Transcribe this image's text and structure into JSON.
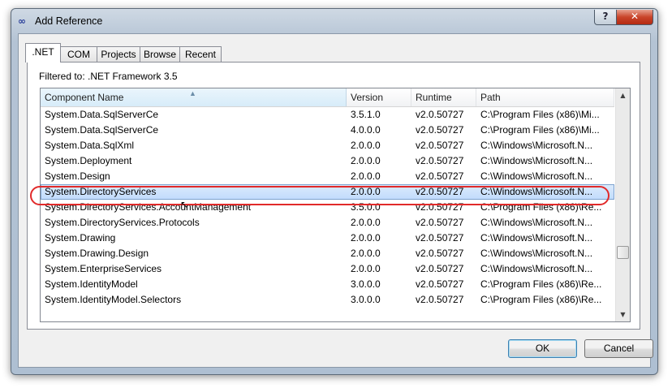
{
  "window": {
    "title": "Add Reference",
    "help_label": "?",
    "close_label": "✕",
    "icon": "visual-studio-infinity-icon"
  },
  "tabs": [
    {
      "label": ".NET",
      "active": true
    },
    {
      "label": "COM",
      "active": false
    },
    {
      "label": "Projects",
      "active": false
    },
    {
      "label": "Browse",
      "active": false
    },
    {
      "label": "Recent",
      "active": false
    }
  ],
  "filter_text": "Filtered to: .NET Framework 3.5",
  "list": {
    "columns": [
      "Component Name",
      "Version",
      "Runtime",
      "Path"
    ],
    "sorted_column": "Component Name",
    "rows": [
      {
        "name": "System.Data.SqlServerCe",
        "version": "3.5.1.0",
        "runtime": "v2.0.50727",
        "path": "C:\\Program Files (x86)\\Mi..."
      },
      {
        "name": "System.Data.SqlServerCe",
        "version": "4.0.0.0",
        "runtime": "v2.0.50727",
        "path": "C:\\Program Files (x86)\\Mi..."
      },
      {
        "name": "System.Data.SqlXml",
        "version": "2.0.0.0",
        "runtime": "v2.0.50727",
        "path": "C:\\Windows\\Microsoft.N..."
      },
      {
        "name": "System.Deployment",
        "version": "2.0.0.0",
        "runtime": "v2.0.50727",
        "path": "C:\\Windows\\Microsoft.N..."
      },
      {
        "name": "System.Design",
        "version": "2.0.0.0",
        "runtime": "v2.0.50727",
        "path": "C:\\Windows\\Microsoft.N..."
      },
      {
        "name": "System.DirectoryServices",
        "version": "2.0.0.0",
        "runtime": "v2.0.50727",
        "path": "C:\\Windows\\Microsoft.N...",
        "selected": true
      },
      {
        "name": "System.DirectoryServices.AccountManagement",
        "version": "3.5.0.0",
        "runtime": "v2.0.50727",
        "path": "C:\\Program Files (x86)\\Re..."
      },
      {
        "name": "System.DirectoryServices.Protocols",
        "version": "2.0.0.0",
        "runtime": "v2.0.50727",
        "path": "C:\\Windows\\Microsoft.N..."
      },
      {
        "name": "System.Drawing",
        "version": "2.0.0.0",
        "runtime": "v2.0.50727",
        "path": "C:\\Windows\\Microsoft.N..."
      },
      {
        "name": "System.Drawing.Design",
        "version": "2.0.0.0",
        "runtime": "v2.0.50727",
        "path": "C:\\Windows\\Microsoft.N..."
      },
      {
        "name": "System.EnterpriseServices",
        "version": "2.0.0.0",
        "runtime": "v2.0.50727",
        "path": "C:\\Windows\\Microsoft.N..."
      },
      {
        "name": "System.IdentityModel",
        "version": "3.0.0.0",
        "runtime": "v2.0.50727",
        "path": "C:\\Program Files (x86)\\Re..."
      },
      {
        "name": "System.IdentityModel.Selectors",
        "version": "3.0.0.0",
        "runtime": "v2.0.50727",
        "path": "C:\\Program Files (x86)\\Re..."
      }
    ]
  },
  "buttons": {
    "ok": "OK",
    "cancel": "Cancel"
  },
  "icons": {
    "scroll_up": "▲",
    "scroll_down": "▼",
    "sort": "▲",
    "cursor": "↖"
  },
  "colors": {
    "selection": "#c1dbfc",
    "annotation_ring": "#e12a2a",
    "close_button": "#c9442a"
  }
}
